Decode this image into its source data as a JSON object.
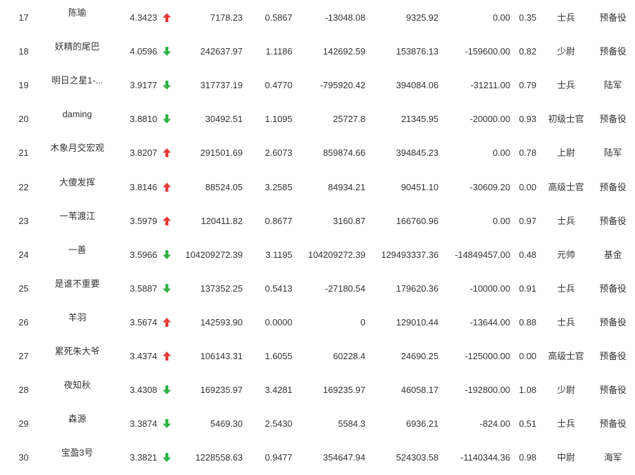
{
  "colors": {
    "up": "#e53935",
    "down": "#2fb344",
    "text": "#333333"
  },
  "table": {
    "rows": [
      {
        "rank": "17",
        "name": "陈瑜",
        "score": "4.3423",
        "trend": "up",
        "v1": "7178.23",
        "v2": "0.5867",
        "v3": "-13048.08",
        "v4": "9325.92",
        "v5": "0.00",
        "v6": "0.35",
        "rank_title": "士兵",
        "branch": "预备役"
      },
      {
        "rank": "18",
        "name": "妖精的尾巴",
        "score": "4.0596",
        "trend": "down",
        "v1": "242637.97",
        "v2": "1.1186",
        "v3": "142692.59",
        "v4": "153876.13",
        "v5": "-159600.00",
        "v6": "0.82",
        "rank_title": "少尉",
        "branch": "预备役"
      },
      {
        "rank": "19",
        "name": "明日之星1-...",
        "score": "3.9177",
        "trend": "down",
        "v1": "317737.19",
        "v2": "0.4770",
        "v3": "-795920.42",
        "v4": "394084.06",
        "v5": "-31211.00",
        "v6": "0.79",
        "rank_title": "士兵",
        "branch": "陆军"
      },
      {
        "rank": "20",
        "name": "daming",
        "score": "3.8810",
        "trend": "down",
        "v1": "30492.51",
        "v2": "1.1095",
        "v3": "25727.8",
        "v4": "21345.95",
        "v5": "-20000.00",
        "v6": "0.93",
        "rank_title": "初级士官",
        "branch": "预备役"
      },
      {
        "rank": "21",
        "name": "木象月交宏观",
        "score": "3.8207",
        "trend": "up",
        "v1": "291501.69",
        "v2": "2.6073",
        "v3": "859874.66",
        "v4": "394845.23",
        "v5": "0.00",
        "v6": "0.78",
        "rank_title": "上尉",
        "branch": "陆军"
      },
      {
        "rank": "22",
        "name": "大傻发挥",
        "score": "3.8146",
        "trend": "up",
        "v1": "88524.05",
        "v2": "3.2585",
        "v3": "84934.21",
        "v4": "90451.10",
        "v5": "-30609.20",
        "v6": "0.00",
        "rank_title": "高级士官",
        "branch": "预备役"
      },
      {
        "rank": "23",
        "name": "一苇渡江",
        "score": "3.5979",
        "trend": "up",
        "v1": "120411.82",
        "v2": "0.8677",
        "v3": "3160.87",
        "v4": "166760.96",
        "v5": "0.00",
        "v6": "0.97",
        "rank_title": "士兵",
        "branch": "预备役"
      },
      {
        "rank": "24",
        "name": "一善",
        "score": "3.5966",
        "trend": "down",
        "v1": "104209272.39",
        "v2": "3.1195",
        "v3": "104209272.39",
        "v4": "129493337.36",
        "v5": "-14849457.00",
        "v6": "0.48",
        "rank_title": "元帅",
        "branch": "基金"
      },
      {
        "rank": "25",
        "name": "是谁不重要",
        "score": "3.5887",
        "trend": "down",
        "v1": "137352.25",
        "v2": "0.5413",
        "v3": "-27180.54",
        "v4": "179620.36",
        "v5": "-10000.00",
        "v6": "0.91",
        "rank_title": "士兵",
        "branch": "预备役"
      },
      {
        "rank": "26",
        "name": "羊羽",
        "score": "3.5674",
        "trend": "up",
        "v1": "142593.90",
        "v2": "0.0000",
        "v3": "0",
        "v4": "129010.44",
        "v5": "-13644.00",
        "v6": "0.88",
        "rank_title": "士兵",
        "branch": "预备役"
      },
      {
        "rank": "27",
        "name": "累死朱大爷",
        "score": "3.4374",
        "trend": "up",
        "v1": "106143.31",
        "v2": "1.6055",
        "v3": "60228.4",
        "v4": "24690.25",
        "v5": "-125000.00",
        "v6": "0.00",
        "rank_title": "高级士官",
        "branch": "预备役"
      },
      {
        "rank": "28",
        "name": "夜知秋",
        "score": "3.4308",
        "trend": "down",
        "v1": "169235.97",
        "v2": "3.4281",
        "v3": "169235.97",
        "v4": "46058.17",
        "v5": "-192800.00",
        "v6": "1.08",
        "rank_title": "少尉",
        "branch": "预备役"
      },
      {
        "rank": "29",
        "name": "森源",
        "score": "3.3874",
        "trend": "down",
        "v1": "5469.30",
        "v2": "2.5430",
        "v3": "5584.3",
        "v4": "6936.21",
        "v5": "-824.00",
        "v6": "0.51",
        "rank_title": "士兵",
        "branch": "预备役"
      },
      {
        "rank": "30",
        "name": "宝盈3号",
        "score": "3.3821",
        "trend": "down",
        "v1": "1228558.63",
        "v2": "0.9477",
        "v3": "354647.94",
        "v4": "524303.58",
        "v5": "-1140344.36",
        "v6": "0.98",
        "rank_title": "中尉",
        "branch": "海军"
      }
    ]
  }
}
